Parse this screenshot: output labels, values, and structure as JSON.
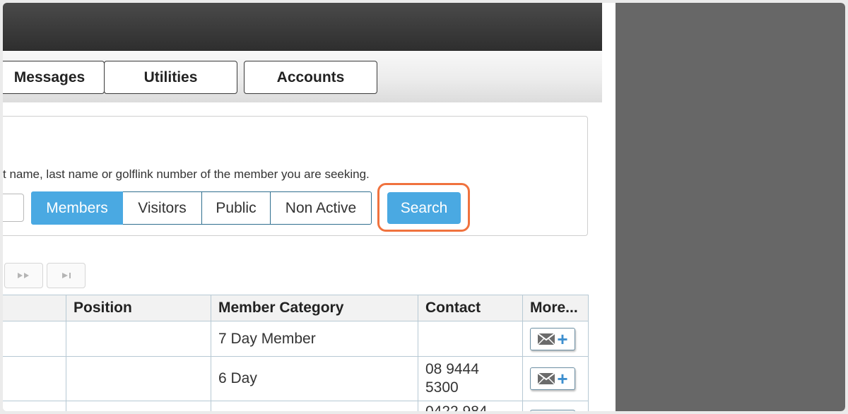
{
  "nav": {
    "buttons": [
      {
        "label": "Messages"
      },
      {
        "label": "Utilities"
      },
      {
        "label": "Accounts"
      }
    ]
  },
  "search": {
    "hint": "t name, last name or golflink number of the member you are seeking.",
    "input_value": "",
    "filters": [
      {
        "label": "Members",
        "selected": true
      },
      {
        "label": "Visitors",
        "selected": false
      },
      {
        "label": "Public",
        "selected": false
      },
      {
        "label": "Non Active",
        "selected": false
      }
    ],
    "button_label": "Search",
    "highlight_color": "#f0723e",
    "accent_color": "#4aa9e2"
  },
  "pager": {
    "next_icon": "fast-forward-icon",
    "last_icon": "skip-to-end-icon"
  },
  "table": {
    "columns": [
      "",
      "Position",
      "Member Category",
      "Contact",
      "More..."
    ],
    "rows": [
      {
        "position": "",
        "category": "7 Day Member",
        "contact": ""
      },
      {
        "position": "",
        "category": "6 Day",
        "contact": "08 9444 5300"
      },
      {
        "position": "",
        "category": "",
        "contact": "0422 984"
      }
    ],
    "row_action_icon": "email-add-icon"
  }
}
